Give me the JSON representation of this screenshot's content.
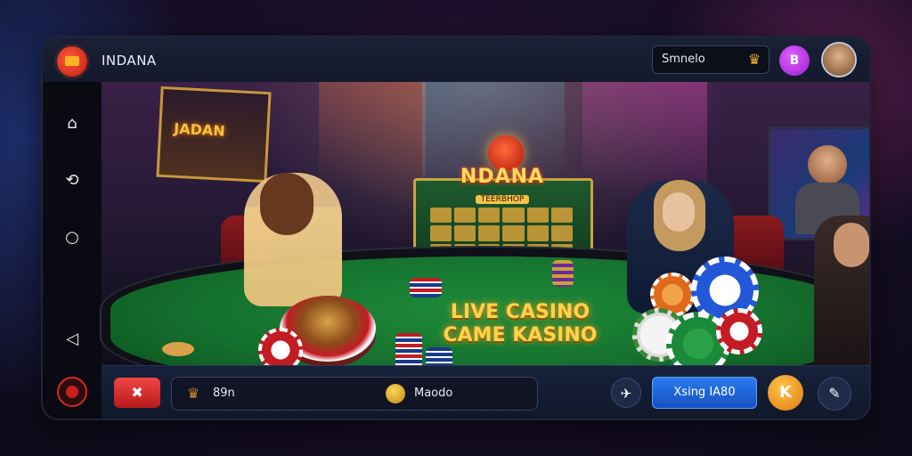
{
  "header": {
    "app_title": "INDANA",
    "search_value": "Smnelo",
    "trophy_icon": "trophy-icon",
    "badge_button_label": "B",
    "avatar": "user-avatar"
  },
  "sidebar": {
    "items": [
      {
        "icon": "home-icon",
        "glyph": "⌂"
      },
      {
        "icon": "refresh-icon",
        "glyph": "⟲"
      },
      {
        "icon": "circle-icon",
        "glyph": "○"
      },
      {
        "icon": "back-icon",
        "glyph": "◁"
      },
      {
        "icon": "record-icon",
        "glyph": ""
      }
    ]
  },
  "scene": {
    "poster_text": "JADAN",
    "sign_title": "NDANA",
    "sign_subtitle": "TEERBHOP",
    "headline_line1": "LIVE CASINO",
    "headline_line2": "CAME KASINO"
  },
  "bottom": {
    "close_label": "✖",
    "stat1_icon": "crown-icon",
    "stat1_value": "89n",
    "stat2_icon": "coin-icon",
    "stat2_value": "Maodo",
    "pin_glyph": "✈",
    "primary_label": "Xsing IA80",
    "gold_glyph": "K",
    "edit_glyph": "✎"
  },
  "colors": {
    "accent_blue": "#2a7cf0",
    "accent_red": "#f04545",
    "gold": "#ffc44a",
    "table_green": "#1e8a3a"
  }
}
